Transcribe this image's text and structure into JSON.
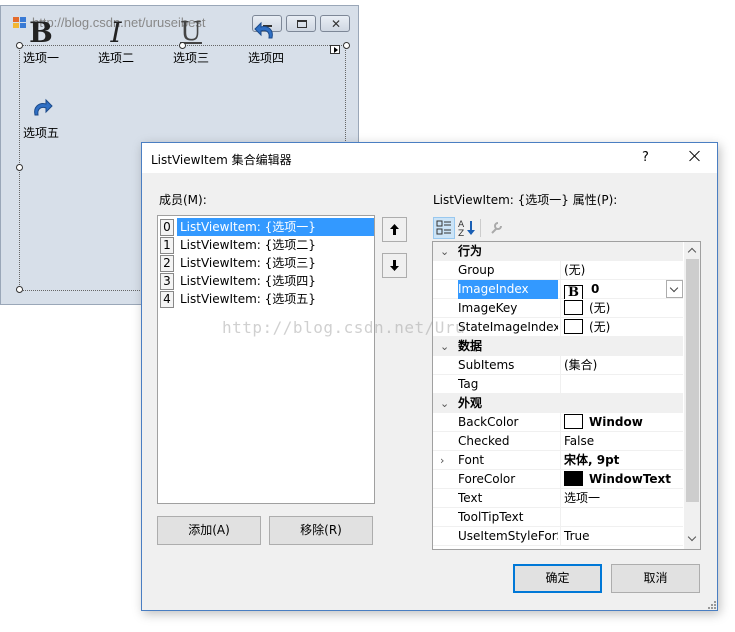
{
  "background_form": {
    "title": "http://blog.csdn.net/uruseibest",
    "items": [
      {
        "label": "选项一",
        "icon": "bold-icon",
        "glyph": "B"
      },
      {
        "label": "选项二",
        "icon": "italic-icon",
        "glyph": "I"
      },
      {
        "label": "选项三",
        "icon": "underline-icon",
        "glyph": "U"
      },
      {
        "label": "选项四",
        "icon": "undo-icon"
      },
      {
        "label": "选项五",
        "icon": "redo-icon"
      }
    ]
  },
  "dialog": {
    "title": "ListViewItem 集合编辑器",
    "help": "?",
    "members_label": "成员(M):",
    "members": [
      {
        "index": "0",
        "text": "ListViewItem: {选项一}",
        "selected": true
      },
      {
        "index": "1",
        "text": "ListViewItem: {选项二}"
      },
      {
        "index": "2",
        "text": "ListViewItem: {选项三}"
      },
      {
        "index": "3",
        "text": "ListViewItem: {选项四}"
      },
      {
        "index": "4",
        "text": "ListViewItem: {选项五}"
      }
    ],
    "add_label": "添加(A)",
    "remove_label": "移除(R)",
    "properties_label": "ListViewItem: {选项一} 属性(P):",
    "ok_label": "确定",
    "cancel_label": "取消"
  },
  "property_grid": {
    "cat_behavior": "行为",
    "cat_data": "数据",
    "cat_appearance": "外观",
    "rows": {
      "group": {
        "name": "Group",
        "value": "(无)"
      },
      "imageindex": {
        "name": "ImageIndex",
        "value": "0",
        "preview": "B"
      },
      "imagekey": {
        "name": "ImageKey",
        "value": "(无)"
      },
      "stateimageindex": {
        "name": "StateImageIndex",
        "value": "(无)"
      },
      "subitems": {
        "name": "SubItems",
        "value": "(集合)"
      },
      "tag": {
        "name": "Tag",
        "value": ""
      },
      "backcolor": {
        "name": "BackColor",
        "value": "Window",
        "swatch": "#ffffff"
      },
      "checked": {
        "name": "Checked",
        "value": "False"
      },
      "font": {
        "name": "Font",
        "value": "宋体, 9pt"
      },
      "forecolor": {
        "name": "ForeColor",
        "value": "WindowText",
        "swatch": "#000000"
      },
      "text": {
        "name": "Text",
        "value": "选项一"
      },
      "tooltiptext": {
        "name": "ToolTipText",
        "value": ""
      },
      "useitemstyle": {
        "name": "UseItemStyleForS",
        "value": "True"
      }
    }
  },
  "watermark": "http://blog.csdn.net/Uru",
  "colors": {
    "selection": "#3399ff",
    "dialog_border": "#4a7ec2",
    "default_button_border": "#0078d7"
  }
}
